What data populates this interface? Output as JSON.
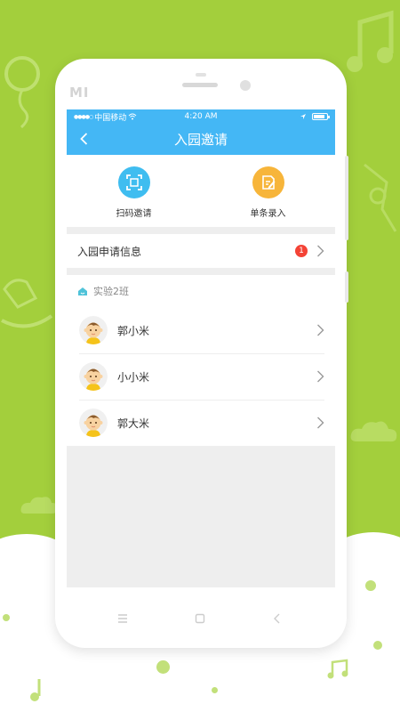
{
  "brand_logo": "MI",
  "status_bar": {
    "signal": "●●●●○",
    "carrier": "中国移动",
    "time": "4:20 AM"
  },
  "nav": {
    "title": "入园邀请"
  },
  "actions": [
    {
      "label": "扫码邀请",
      "icon": "scan-icon",
      "color": "#3fbdf0"
    },
    {
      "label": "单条录入",
      "icon": "edit-icon",
      "color": "#f7b53a"
    }
  ],
  "apply_row": {
    "label": "入园申请信息",
    "badge": "1"
  },
  "class_section": {
    "name": "实验2班",
    "members": [
      {
        "name": "郭小米"
      },
      {
        "name": "小小米"
      },
      {
        "name": "郭大米"
      }
    ]
  },
  "colors": {
    "accent": "#44b7f5",
    "background": "#a3cf3c",
    "badge": "#f44336"
  }
}
